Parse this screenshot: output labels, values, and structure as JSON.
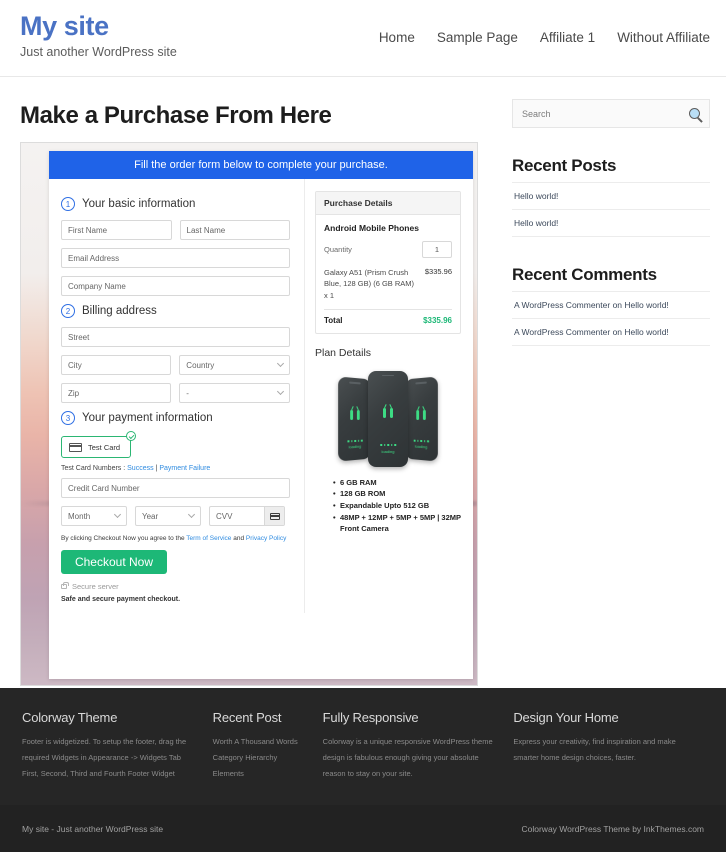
{
  "header": {
    "brand_title": "My site",
    "brand_tagline": "Just another WordPress site",
    "nav": [
      {
        "label": "Home"
      },
      {
        "label": "Sample Page"
      },
      {
        "label": "Affiliate 1"
      },
      {
        "label": "Without Affiliate"
      }
    ]
  },
  "main": {
    "page_title": "Make a Purchase From Here",
    "banner": "Fill the order form below to complete your purchase.",
    "steps": {
      "one_num": "1",
      "one_label": "Your basic information",
      "two_num": "2",
      "two_label": "Billing address",
      "three_num": "3",
      "three_label": "Your payment information"
    },
    "fields": {
      "first_name": "First Name",
      "last_name": "Last Name",
      "email": "Email Address",
      "company": "Company Name",
      "street": "Street",
      "city": "City",
      "country": "Country",
      "zip": "Zip",
      "state": "-",
      "credit_card": "Credit Card Number",
      "month": "Month",
      "year": "Year",
      "cvv": "CVV"
    },
    "payment": {
      "test_card_label": "Test Card",
      "test_numbers_prefix": "Test Card Numbers : ",
      "test_success": "Success",
      "test_separator": " | ",
      "test_failure": "Payment Failure",
      "terms_prefix": "By clicking Checkout Now you agree to the ",
      "terms_tos": "Term of Service",
      "terms_and": " and ",
      "terms_privacy": "Privacy Policy",
      "checkout_label": "Checkout Now",
      "secure_server": "Secure server",
      "safe_note": "Safe and secure payment checkout."
    },
    "purchase": {
      "heading": "Purchase Details",
      "product": "Android Mobile Phones",
      "qty_label": "Quantity",
      "qty_value": "1",
      "line_desc": "Galaxy A51 (Prism Crush Blue, 128 GB) (6 GB RAM) x 1",
      "line_amount": "$335.96",
      "total_label": "Total",
      "total_amount": "$335.96"
    },
    "plan": {
      "title": "Plan Details",
      "loading_text": "loading",
      "specs": [
        "6 GB RAM",
        "128 GB ROM",
        "Expandable Upto 512 GB",
        "48MP + 12MP + 5MP + 5MP | 32MP Front Camera"
      ]
    }
  },
  "sidebar": {
    "search_placeholder": "Search",
    "recent_posts_title": "Recent Posts",
    "recent_posts": [
      {
        "label": "Hello world!"
      },
      {
        "label": "Hello world!"
      }
    ],
    "recent_comments_title": "Recent Comments",
    "recent_comments": [
      {
        "label": "A WordPress Commenter on Hello world!"
      },
      {
        "label": "A WordPress Commenter on Hello world!"
      }
    ]
  },
  "footer": {
    "columns": [
      {
        "heading": "Colorway Theme",
        "text": "Footer is widgetized. To setup the footer, drag the required Widgets in Appearance -> Widgets Tab First, Second, Third and Fourth Footer Widget"
      },
      {
        "heading": "Recent Post",
        "links": [
          {
            "label": "Worth A Thousand Words"
          },
          {
            "label": "Category Hierarchy"
          },
          {
            "label": "Elements"
          }
        ]
      },
      {
        "heading": "Fully Responsive",
        "text": "Colorway is a unique responsive WordPress theme design is fabulous enough giving your absolute reason to stay on your site."
      },
      {
        "heading": "Design Your Home",
        "text": "Express your creativity, find inspiration and make smarter home design choices, faster."
      }
    ],
    "copyright_left": "My site - Just another WordPress site",
    "copyright_right": "Colorway WordPress Theme by InkThemes.com"
  },
  "colors": {
    "brand": "#4a72c4",
    "banner_blue": "#1f63e8",
    "accent_green": "#1db877",
    "link_blue": "#2f8be0",
    "footer_bg": "#262626"
  }
}
